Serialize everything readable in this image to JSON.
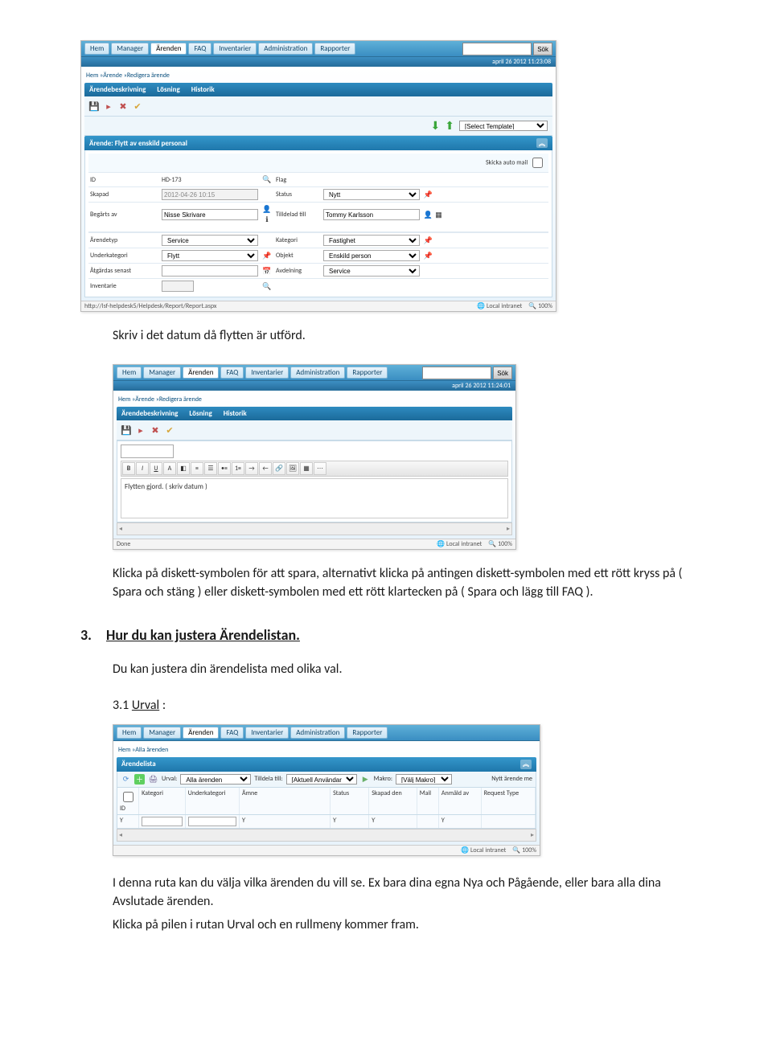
{
  "nav": {
    "items": [
      "Hem",
      "Manager",
      "Ärenden",
      "FAQ",
      "Inventarier",
      "Administration",
      "Rapporter"
    ],
    "search_btn": "Sök",
    "date1": "april 26 2012 11:23:08",
    "date2": "april 26 2012 11:24:01"
  },
  "bc1": "Hem »Ärende »Redigera ärende",
  "tabs": {
    "a": "Ärendebeskrivning",
    "b": "Lösning",
    "c": "Historik"
  },
  "tmpl": {
    "select": "[Select Template]"
  },
  "panel_title": "Ärende: Flytt av enskild personal",
  "auto_mail": "Skicka auto mail",
  "form": {
    "id_lbl": "ID",
    "id_val": "HD-173",
    "flag_lbl": "Flag",
    "skapad_lbl": "Skapad",
    "skapad_val": "2012-04-26 10:15",
    "status_lbl": "Status",
    "status_val": "Nytt",
    "begarts_lbl": "Begärts av",
    "begarts_val": "Nisse Skrivare",
    "tilldelad_lbl": "Tilldelad till",
    "tilldelad_val": "Tommy Karlsson",
    "arendetyp_lbl": "Ärendetyp",
    "arendetyp_val": "Service",
    "kategori_lbl": "Kategori",
    "kategori_val": "Fastighet",
    "underkat_lbl": "Underkategori",
    "underkat_val": "Flytt",
    "objekt_lbl": "Objekt",
    "objekt_val": "Enskild person",
    "atgardas_lbl": "Åtgärdas senast",
    "avdelning_lbl": "Avdelning",
    "avdelning_val": "Service",
    "inventarie_lbl": "Inventarie"
  },
  "status_url": "http://lsf-helpdesk5/Helpdesk/Report/Report.aspx",
  "status_done": "Done",
  "intranet": "Local intranet",
  "zoom": "100%",
  "text1": "Skriv i det datum då flytten är utförd.",
  "editor_text": "Flytten gjord. ( skriv datum )",
  "text2": "Klicka på diskett-symbolen för att spara, alternativt klicka på antingen diskett-symbolen med ett rött kryss på ( Spara och stäng ) eller diskett-symbolen med ett rött klartecken på ( Spara och lägg till FAQ ).",
  "section3_num": "3.",
  "section3": "Hur du kan justera Ärendelistan.",
  "text3": "Du kan justera din ärendelista med olika val.",
  "sub31_num": "3.1",
  "sub31": "Urval",
  "bc3": "Hem »Alla ärenden",
  "panel3": "Ärendelista",
  "list_tb": {
    "urval_lbl": "Urval:",
    "urval_val": "Alla ärenden",
    "tilldela_lbl": "Tilldela till:",
    "tilldela_val": "[Aktuell Användare]",
    "makro_lbl": "Makro:",
    "makro_val": "[Välj Makro]",
    "nytt": "Nytt ärende me"
  },
  "cols": {
    "id": "ID",
    "kat": "Kategori",
    "uk": "Underkategori",
    "amne": "Ämne",
    "status": "Status",
    "skap": "Skapad den",
    "mail": "Mail",
    "anm": "Anmäld av",
    "req": "Request Type"
  },
  "filter_sym": "Ƴ",
  "text4": "I denna ruta kan du välja vilka ärenden du vill se. Ex bara dina egna Nya och Pågående, eller bara alla dina Avslutade ärenden.",
  "text5": "Klicka på pilen i rutan Urval och en rullmeny kommer fram."
}
